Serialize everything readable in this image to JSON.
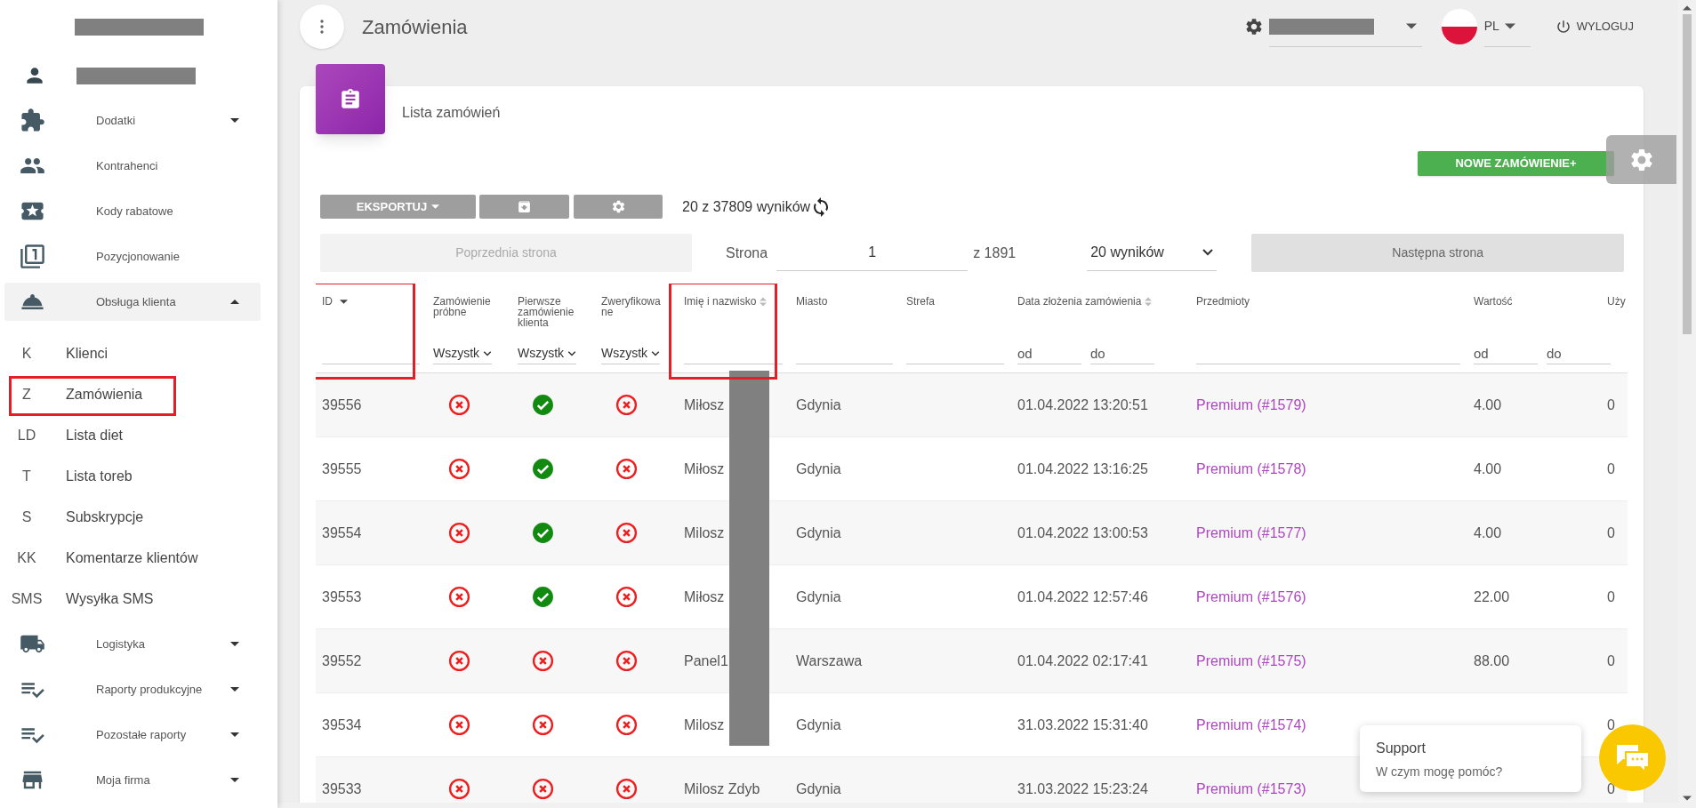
{
  "sidebar": {
    "items": [
      {
        "label": "Dodatki",
        "expanded": false
      },
      {
        "label": "Kontrahenci"
      },
      {
        "label": "Kody rabatowe"
      },
      {
        "label": "Pozycjonowanie"
      },
      {
        "label": "Obsługa klienta",
        "expanded": true,
        "children": [
          {
            "abbr": "K",
            "label": "Klienci"
          },
          {
            "abbr": "Z",
            "label": "Zamówienia",
            "annotated": true
          },
          {
            "abbr": "LD",
            "label": "Lista diet"
          },
          {
            "abbr": "T",
            "label": "Lista toreb"
          },
          {
            "abbr": "S",
            "label": "Subskrypcje"
          },
          {
            "abbr": "KK",
            "label": "Komentarze klientów"
          },
          {
            "abbr": "SMS",
            "label": "Wysyłka SMS"
          }
        ]
      },
      {
        "label": "Logistyka",
        "expanded": false
      },
      {
        "label": "Raporty produkcyjne",
        "expanded": false
      },
      {
        "label": "Pozostałe raporty",
        "expanded": false
      },
      {
        "label": "Moja firma",
        "expanded": false
      }
    ]
  },
  "header": {
    "title": "Zamówienia",
    "language": "PL",
    "logout": "WYLOGUJ"
  },
  "card": {
    "title": "Lista zamówień",
    "new_order_button": "NOWE ZAMÓWIENIE+",
    "export_button": "EKSPORTUJ",
    "results": "20 z 37809 wyników",
    "pagination": {
      "prev": {
        "label": "Poprzednia strona",
        "disabled": true
      },
      "page_label": "Strona",
      "page": "1",
      "page_total": "z 1891",
      "page_size": "20 wyników",
      "next": {
        "label": "Następna strona",
        "disabled": false
      }
    }
  },
  "table": {
    "columns": [
      {
        "label": "ID",
        "sorted_desc": true,
        "filter": {
          "kind": "text"
        },
        "annotated": true
      },
      {
        "label": "Zamówienie próbne",
        "filter": {
          "kind": "select",
          "value": "Wszystk"
        }
      },
      {
        "label": "Pierwsze zamówienie klienta",
        "filter": {
          "kind": "select",
          "value": "Wszystk"
        }
      },
      {
        "label": "Zweryfikowane",
        "filter": {
          "kind": "select",
          "value": "Wszystk"
        }
      },
      {
        "label": "Imię i nazwisko",
        "sortable": true,
        "filter": {
          "kind": "text"
        },
        "annotated": true
      },
      {
        "label": "Miasto",
        "filter": {
          "kind": "text"
        }
      },
      {
        "label": "Strefa",
        "filter": {
          "kind": "text"
        }
      },
      {
        "label": "Data złożenia zamówienia",
        "sortable": true,
        "filter": {
          "kind": "range",
          "from": {
            "placeholder": "od"
          },
          "to": {
            "placeholder": "do"
          }
        }
      },
      {
        "label": "Przedmioty",
        "filter": {
          "kind": "text"
        }
      },
      {
        "label": "Wartość",
        "filter": {
          "kind": "range",
          "from": {
            "placeholder": "od"
          },
          "to": {
            "placeholder": "do"
          }
        }
      },
      {
        "label": "Uży"
      }
    ],
    "rows": [
      {
        "id": "39556",
        "trial": false,
        "first_order": true,
        "verified": false,
        "name": "Miłosz",
        "city": "Gdynia",
        "date": "01.04.2022 13:20:51",
        "item": "Premium (#1579)",
        "value": "4.00",
        "column_11": "0"
      },
      {
        "id": "39555",
        "trial": false,
        "first_order": true,
        "verified": false,
        "name": "Miłosz",
        "city": "Gdynia",
        "date": "01.04.2022 13:16:25",
        "item": "Premium (#1578)",
        "value": "4.00",
        "column_11": "0"
      },
      {
        "id": "39554",
        "trial": false,
        "first_order": true,
        "verified": false,
        "name": "Milosz",
        "city": "Gdynia",
        "date": "01.04.2022 13:00:53",
        "item": "Premium (#1577)",
        "value": "4.00",
        "column_11": "0"
      },
      {
        "id": "39553",
        "trial": false,
        "first_order": true,
        "verified": false,
        "name": "Miłosz",
        "city": "Gdynia",
        "date": "01.04.2022 12:57:46",
        "item": "Premium (#1576)",
        "value": "22.00",
        "column_11": "0"
      },
      {
        "id": "39552",
        "trial": false,
        "first_order": false,
        "verified": false,
        "name": "Panel1",
        "city": "Warszawa",
        "date": "01.04.2022 02:17:41",
        "item": "Premium (#1575)",
        "value": "88.00",
        "column_11": "0"
      },
      {
        "id": "39534",
        "trial": false,
        "first_order": false,
        "verified": false,
        "name": "Milosz",
        "city": "Gdynia",
        "date": "31.03.2022 15:31:40",
        "item": "Premium (#1574)",
        "column_11": "0"
      },
      {
        "id": "39533",
        "trial": false,
        "first_order": false,
        "verified": false,
        "name": "Milosz Zdyb",
        "city": "Gdynia",
        "date": "31.03.2022 15:23:24",
        "item": "Premium (#1573)",
        "column_11": "0"
      }
    ]
  },
  "support": {
    "title": "Support",
    "message": "W czym mogę pomóc?"
  }
}
